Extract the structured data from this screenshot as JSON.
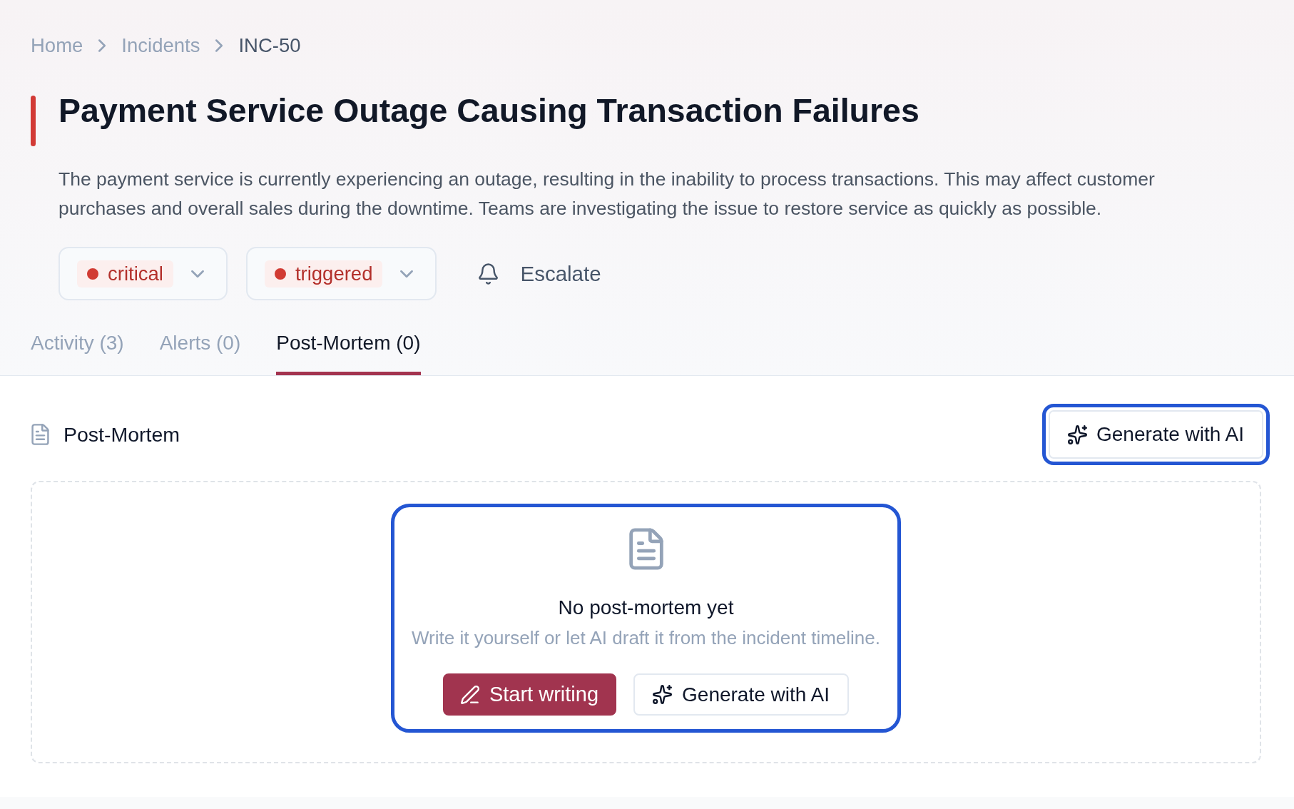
{
  "breadcrumb": [
    {
      "label": "Home",
      "current": false
    },
    {
      "label": "Incidents",
      "current": false
    },
    {
      "label": "INC-50",
      "current": true
    }
  ],
  "incident": {
    "title": "Payment Service Outage Causing Transaction Failures",
    "description": "The payment service is currently experiencing an outage, resulting in the inability to process transactions. This may affect customer purchases and overall sales during the downtime. Teams are investigating the issue to restore service as quickly as possible.",
    "selects": [
      {
        "value": "critical"
      },
      {
        "value": "triggered"
      }
    ],
    "escalate": {
      "label": "Escalate"
    }
  },
  "tabs": [
    {
      "label": "Activity (3)",
      "selected": false
    },
    {
      "label": "Alerts (0)",
      "selected": false
    },
    {
      "label": "Post-Mortem (0)",
      "selected": true
    }
  ],
  "post_mortem": {
    "heading": "Post-Mortem",
    "generate_button": {
      "label": "Generate with AI",
      "focused": true
    },
    "empty_state": {
      "highlighted": true,
      "title": "No post-mortem yet",
      "text": "Write it yourself or let AI draft it from the incident timeline.",
      "actions": [
        {
          "kind": "primary",
          "label": "Start writing"
        },
        {
          "kind": "secondary",
          "label": "Generate with AI"
        }
      ]
    }
  }
}
